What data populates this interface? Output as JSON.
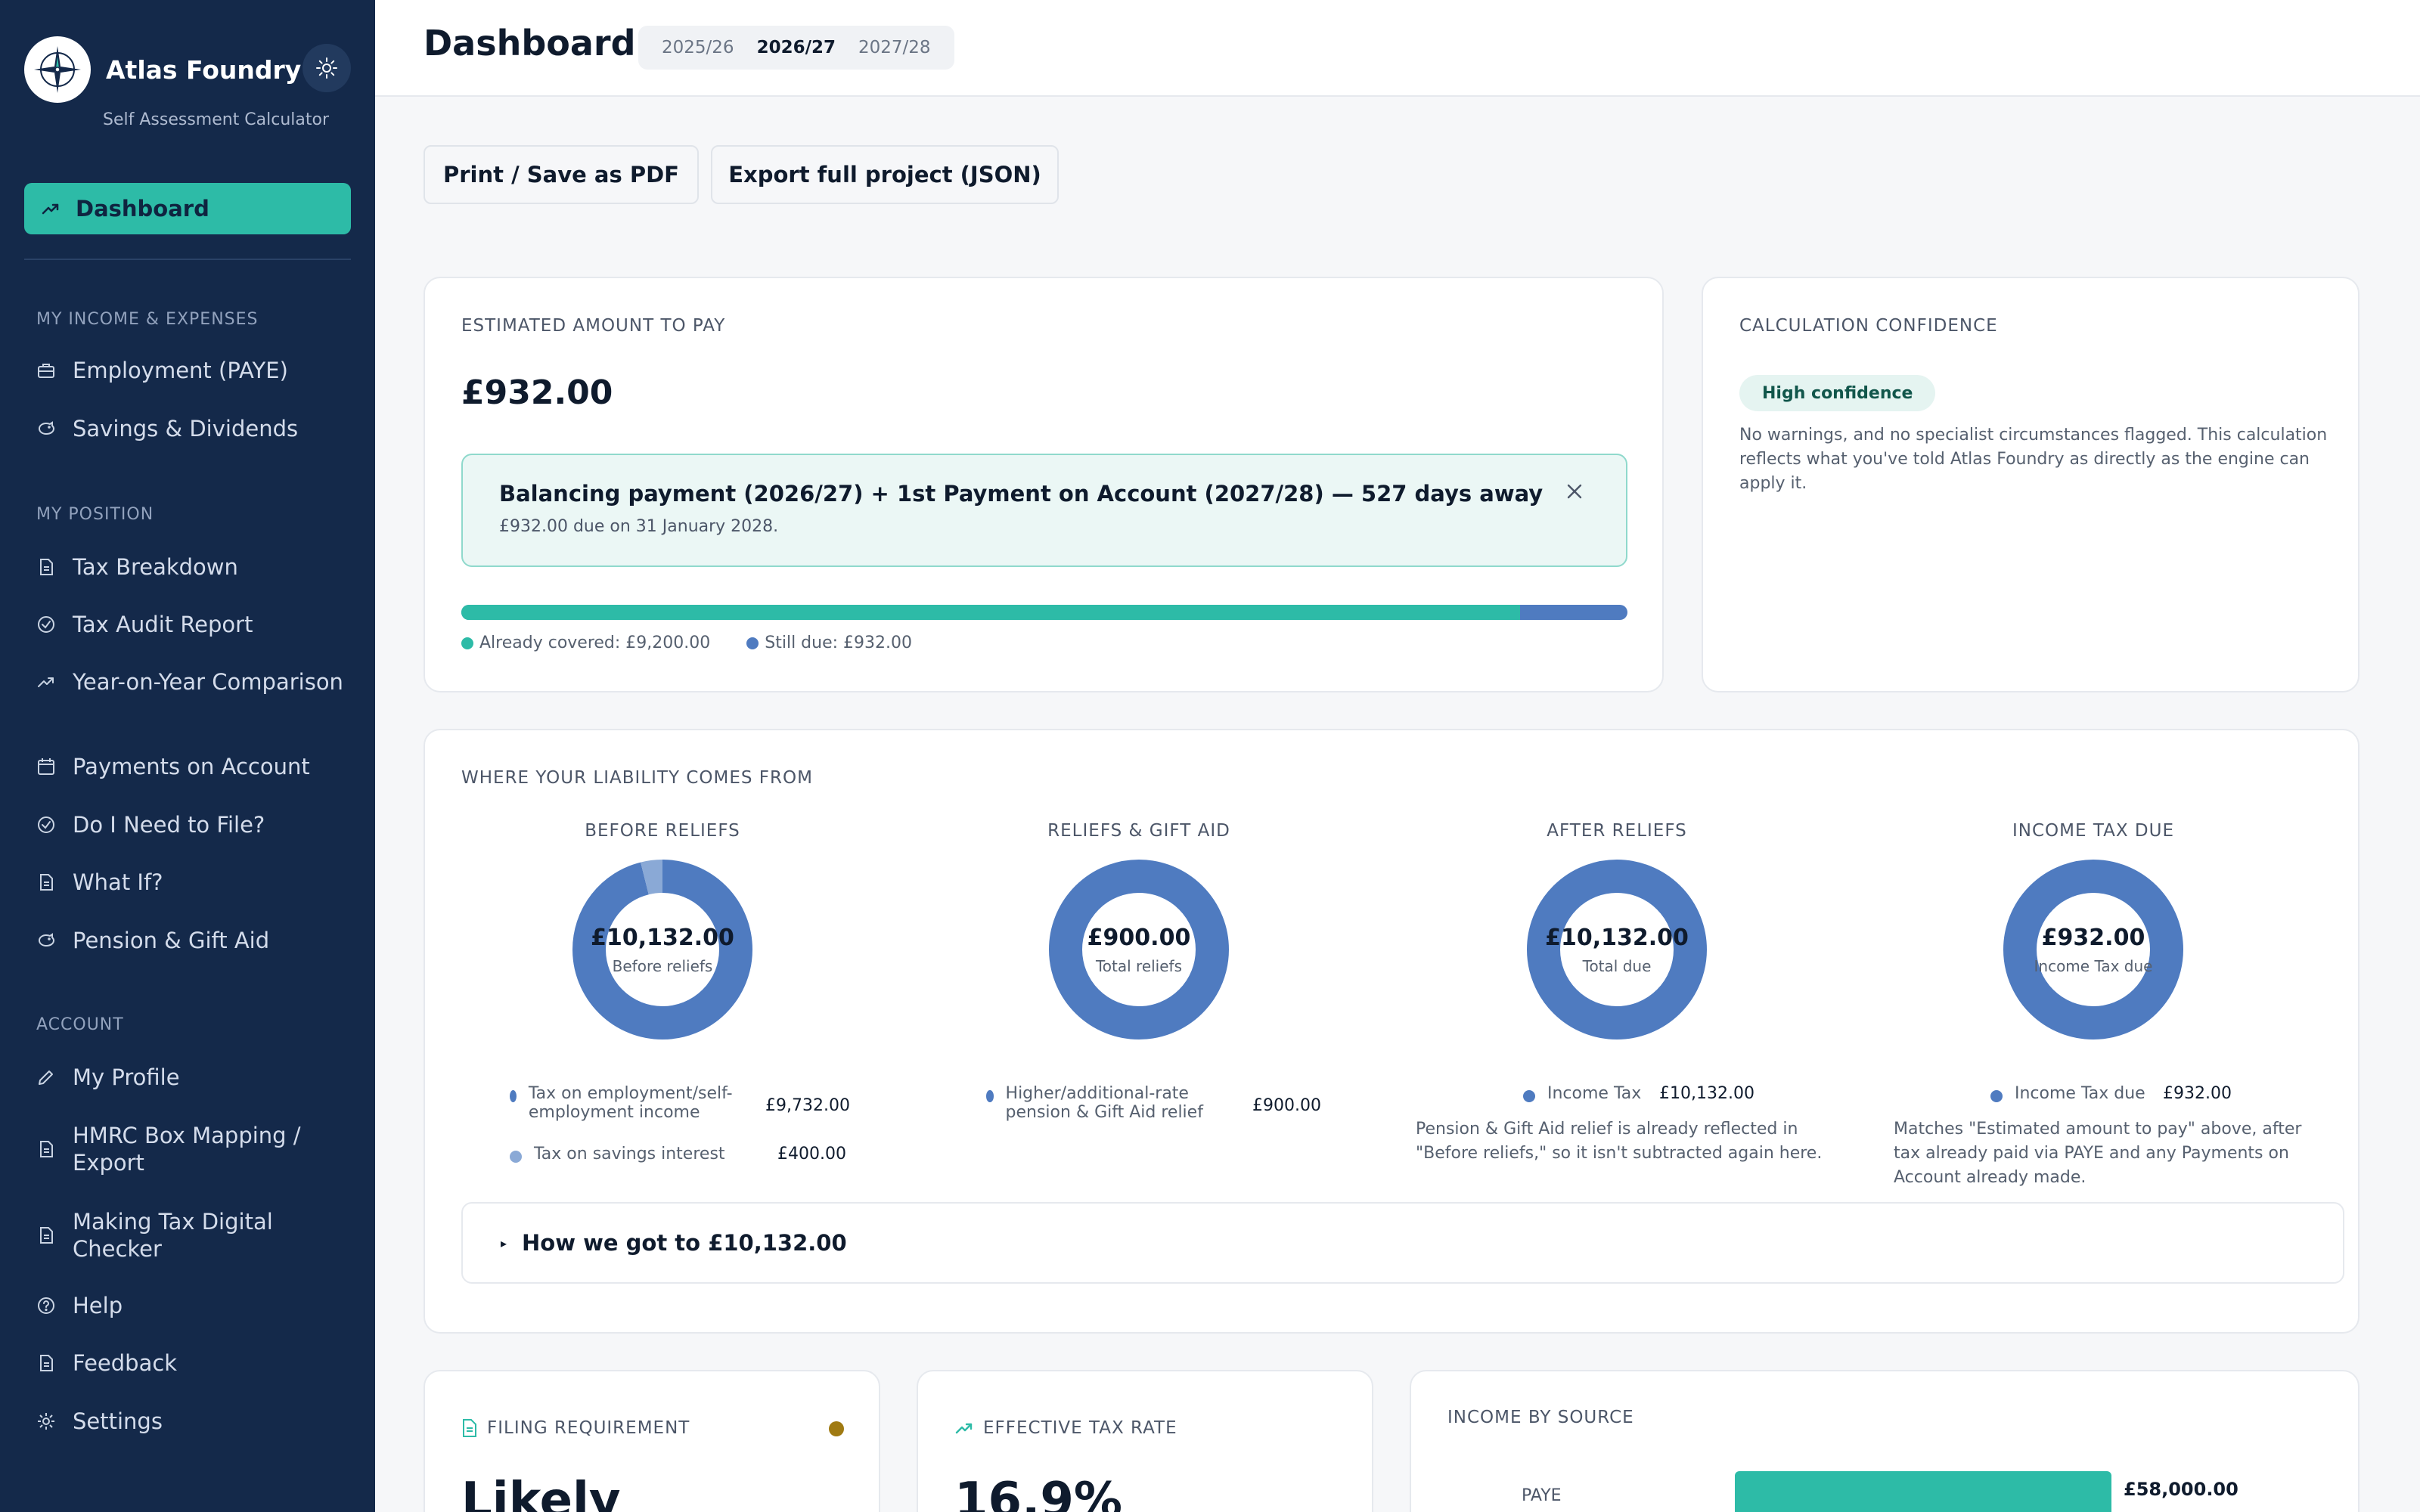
{
  "app": {
    "name": "Atlas Foundry",
    "subtitle": "Self Assessment Calculator"
  },
  "icons": {
    "logo": "compass-rose-icon",
    "theme": "sun-icon",
    "dashboard": "trend-icon",
    "employment": "briefcase-icon",
    "savings": "piggy-bank-icon",
    "document": "document-icon",
    "audit": "check-circle-icon",
    "comparison": "trend-icon",
    "payments": "calendar-icon",
    "file": "check-circle-icon",
    "profile": "pencil-icon",
    "help": "question-circle-icon",
    "settings": "gear-icon",
    "close": "close-icon"
  },
  "colors": {
    "sidebar": "#14294a",
    "accent": "#2dbba7",
    "blue": "#4f7bc0",
    "light_blue": "#8aa9d6",
    "warning": "#a07a12"
  },
  "sidebar": {
    "active": {
      "label": "Dashboard"
    },
    "sections": [
      {
        "title": "MY INCOME & EXPENSES",
        "items": [
          {
            "label": "Employment (PAYE)"
          },
          {
            "label": "Savings & Dividends"
          }
        ]
      },
      {
        "title": "MY POSITION",
        "items": [
          {
            "label": "Tax Breakdown"
          },
          {
            "label": "Tax Audit Report"
          },
          {
            "label": "Year-on-Year Comparison"
          },
          {
            "label": "Payments on Account"
          },
          {
            "label": "Do I Need to File?"
          },
          {
            "label": "What If?"
          },
          {
            "label": "Pension & Gift Aid"
          }
        ]
      },
      {
        "title": "ACCOUNT",
        "items": [
          {
            "label": "My Profile"
          },
          {
            "label": "HMRC Box Mapping / Export"
          },
          {
            "label": "Making Tax Digital Checker"
          },
          {
            "label": "Help"
          },
          {
            "label": "Feedback"
          },
          {
            "label": "Settings"
          }
        ]
      }
    ]
  },
  "header": {
    "title": "Dashboard",
    "years": [
      "2025/26",
      "2026/27",
      "2027/28"
    ],
    "active_year": "2026/27"
  },
  "actions": {
    "print": "Print / Save as PDF",
    "export": "Export full project (JSON)"
  },
  "estimate": {
    "heading": "ESTIMATED AMOUNT TO PAY",
    "amount": "£932.00",
    "notice_title": "Balancing payment (2026/27) + 1st Payment on Account (2027/28) — 527 days away",
    "notice_sub": "£932.00 due on 31 January 2028.",
    "covered_label": "Already covered: £9,200.00",
    "due_label": "Still due: £932.00",
    "covered_value": 9200,
    "due_value": 932
  },
  "confidence": {
    "heading": "CALCULATION CONFIDENCE",
    "badge": "High confidence",
    "text": "No warnings, and no specialist circumstances flagged. This calculation reflects what you've told Atlas Foundry as directly as the engine can apply it."
  },
  "liability": {
    "heading": "WHERE YOUR LIABILITY COMES FROM",
    "columns": [
      {
        "title": "BEFORE RELIEFS",
        "value": "£10,132.00",
        "label": "Before reliefs",
        "items": [
          {
            "label": "Tax on employment/self-employment income",
            "amount": "£9,732.00",
            "share": 9732
          },
          {
            "label": "Tax on savings interest",
            "amount": "£400.00",
            "share": 400
          }
        ]
      },
      {
        "title": "RELIEFS & GIFT AID",
        "value": "£900.00",
        "label": "Total reliefs",
        "items": [
          {
            "label": "Higher/additional-rate pension & Gift Aid relief",
            "amount": "£900.00",
            "share": 900
          }
        ]
      },
      {
        "title": "AFTER RELIEFS",
        "value": "£10,132.00",
        "label": "Total due",
        "items": [
          {
            "label": "Income Tax",
            "amount": "£10,132.00",
            "share": 10132
          }
        ],
        "note": "Pension & Gift Aid relief is already reflected in \"Before reliefs,\" so it isn't subtracted again here."
      },
      {
        "title": "INCOME TAX DUE",
        "value": "£932.00",
        "label": "Income Tax due",
        "items": [
          {
            "label": "Income Tax due",
            "amount": "£932.00",
            "share": 932
          }
        ],
        "note": "Matches \"Estimated amount to pay\" above, after tax already paid via PAYE and any Payments on Account already made."
      }
    ],
    "expander": "How we got to £10,132.00"
  },
  "filing": {
    "heading": "FILING REQUIREMENT",
    "value": "Likely"
  },
  "effective_rate": {
    "heading": "EFFECTIVE TAX RATE",
    "value": "16.9%"
  },
  "income_by_source": {
    "heading": "INCOME BY SOURCE",
    "rows": [
      {
        "label": "PAYE",
        "amount": "£58,000.00",
        "value": 58000
      }
    ]
  }
}
